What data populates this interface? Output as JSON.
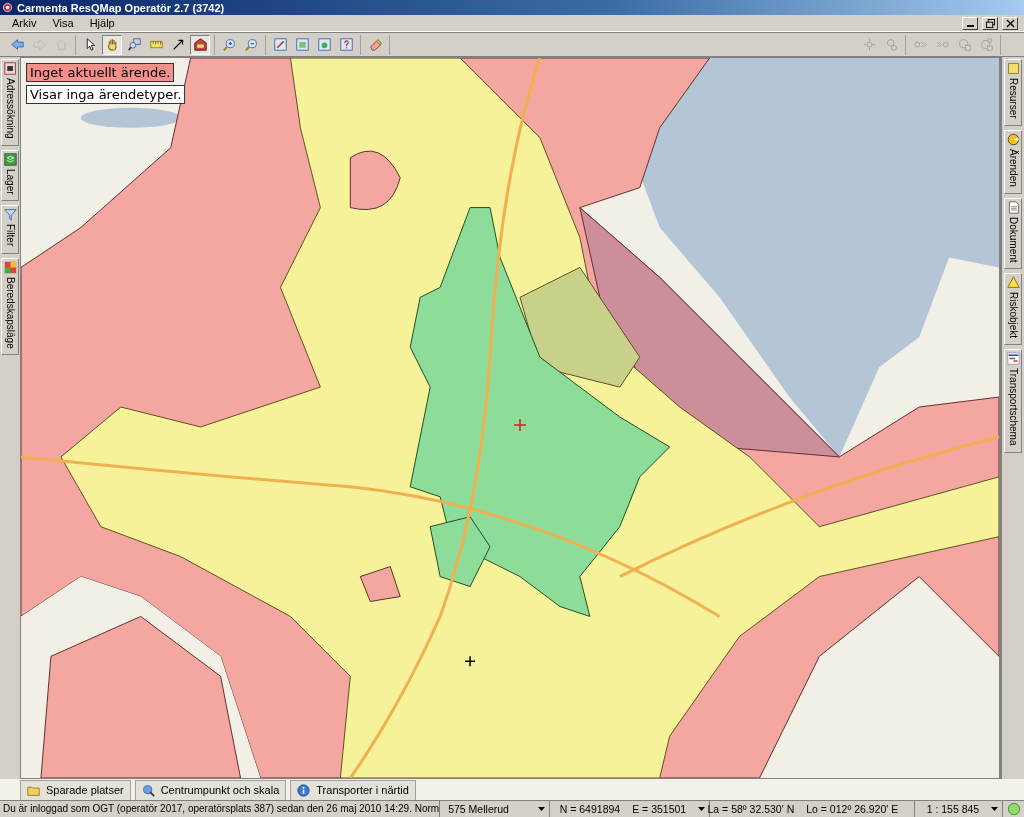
{
  "window": {
    "title": "Carmenta ResQMap Operatör 2.7 (3742)"
  },
  "menu": [
    {
      "label": "Arkiv"
    },
    {
      "label": "Visa"
    },
    {
      "label": "Hjälp"
    }
  ],
  "toolbar": {
    "left_groups": [
      {
        "tools": [
          {
            "kind": "back",
            "selected": false,
            "disabled": false
          },
          {
            "kind": "forward",
            "selected": false,
            "disabled": true
          },
          {
            "kind": "home",
            "selected": false,
            "disabled": true
          }
        ]
      },
      {
        "tools": [
          {
            "kind": "pointer",
            "selected": false,
            "disabled": false
          },
          {
            "kind": "pan",
            "selected": true,
            "disabled": false
          },
          {
            "kind": "zoom-window",
            "selected": false,
            "disabled": false
          },
          {
            "kind": "ruler",
            "selected": false,
            "disabled": false
          },
          {
            "kind": "label-arrow",
            "selected": false,
            "disabled": false
          },
          {
            "kind": "tag",
            "selected": true,
            "disabled": false
          }
        ]
      },
      {
        "tools": [
          {
            "kind": "zoom-in",
            "selected": false,
            "disabled": false
          },
          {
            "kind": "zoom-out",
            "selected": false,
            "disabled": false
          }
        ]
      },
      {
        "tools": [
          {
            "kind": "edit",
            "selected": false,
            "disabled": false
          },
          {
            "kind": "map-a",
            "selected": false,
            "disabled": false
          },
          {
            "kind": "map-b",
            "selected": false,
            "disabled": false
          },
          {
            "kind": "map-help",
            "selected": false,
            "disabled": false
          }
        ]
      },
      {
        "tools": [
          {
            "kind": "eraser",
            "selected": false,
            "disabled": false
          }
        ]
      }
    ],
    "right_groups": [
      {
        "tools": [
          {
            "kind": "center",
            "selected": false,
            "disabled": true
          },
          {
            "kind": "find",
            "selected": false,
            "disabled": true
          }
        ]
      },
      {
        "tools": [
          {
            "kind": "route-out",
            "selected": false,
            "disabled": true
          },
          {
            "kind": "route-in",
            "selected": false,
            "disabled": true
          },
          {
            "kind": "locate",
            "selected": false,
            "disabled": true
          },
          {
            "kind": "locate-multi",
            "selected": false,
            "disabled": true
          }
        ]
      }
    ]
  },
  "left_tabs": [
    {
      "label": "Adressökning",
      "kind": "address"
    },
    {
      "label": "Lager",
      "kind": "layers"
    },
    {
      "label": "Filter",
      "kind": "filter"
    },
    {
      "label": "Beredskapsläge",
      "kind": "readiness"
    }
  ],
  "right_tabs": [
    {
      "label": "Resurser",
      "kind": "resources"
    },
    {
      "label": "Ärenden",
      "kind": "cases"
    },
    {
      "label": "Dokument",
      "kind": "document"
    },
    {
      "label": "Riskobjekt",
      "kind": "risk"
    },
    {
      "label": "Transportschema",
      "kind": "schedule"
    }
  ],
  "map_notices": [
    {
      "text": "Inget aktuellt ärende.",
      "kind": "alert"
    },
    {
      "text": "Visar inga ärendetyper.",
      "kind": "info"
    }
  ],
  "bottom_tabs": [
    {
      "label": "Sparade platser",
      "kind": "folder"
    },
    {
      "label": "Centrumpunkt och skala",
      "kind": "center"
    },
    {
      "label": "Transporter i närtid",
      "kind": "info"
    }
  ],
  "status_bar": {
    "message": "Du är inloggad som OGT (operatör 2017, operatörsplats 387) sedan den 26 maj 2010 14:29. Norm",
    "fields": [
      {
        "texts": [
          "575 Mellerud"
        ]
      },
      {
        "texts": [
          "N = 6491894",
          "E = 351501"
        ]
      },
      {
        "texts": [
          "La = 58º 32.530' N",
          "Lo = 012º 26.920' E"
        ]
      },
      {
        "texts": [
          "1 : 155 845"
        ]
      }
    ]
  }
}
